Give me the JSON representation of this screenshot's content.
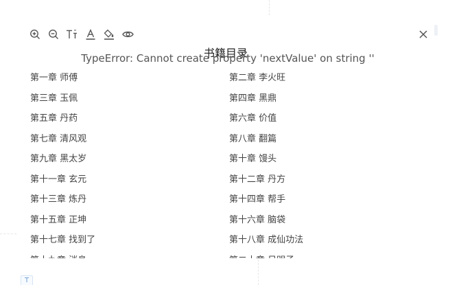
{
  "toolbar": {
    "icons": [
      "zoom-in-icon",
      "zoom-out-icon",
      "text-size-icon",
      "font-color-icon",
      "fill-color-icon",
      "eye-icon"
    ],
    "close_icon": "close-icon"
  },
  "book": {
    "title": "书籍目录",
    "error": "TypeError: Cannot create property 'nextValue' on string ''"
  },
  "chapters": [
    "第一章 师傅",
    "第二章 李火旺",
    "第三章 玉佩",
    "第四章 黑鼎",
    "第五章 丹药",
    "第六章 价值",
    "第七章 清风观",
    "第八章 翻篇",
    "第九章 黑太岁",
    "第十章 馒头",
    "第十一章 玄元",
    "第十二章 丹方",
    "第十三章 炼丹",
    "第十四章 帮手",
    "第十五章 正坤",
    "第十六章 脑袋",
    "第十七章 找到了",
    "第十八章 成仙功法",
    "第十九章 消息",
    "第二十章 日明子"
  ],
  "corner_label": "T",
  "colors": {
    "text": "#444444",
    "icon": "#555555"
  }
}
